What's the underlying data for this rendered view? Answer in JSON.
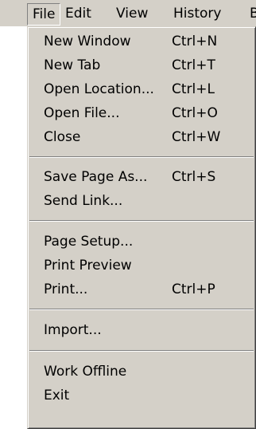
{
  "menubar": {
    "items": [
      {
        "label": "File"
      },
      {
        "label": "Edit"
      },
      {
        "label": "View"
      },
      {
        "label": "History"
      },
      {
        "label": "B"
      }
    ]
  },
  "file_menu": {
    "items": [
      {
        "label": "New Window",
        "shortcut": "Ctrl+N"
      },
      {
        "label": "New Tab",
        "shortcut": "Ctrl+T"
      },
      {
        "label": "Open Location...",
        "shortcut": "Ctrl+L"
      },
      {
        "label": "Open File...",
        "shortcut": "Ctrl+O"
      },
      {
        "label": "Close",
        "shortcut": "Ctrl+W"
      },
      {
        "label": "Save Page As...",
        "shortcut": "Ctrl+S"
      },
      {
        "label": "Send Link..."
      },
      {
        "label": "Page Setup..."
      },
      {
        "label": "Print Preview"
      },
      {
        "label": "Print...",
        "shortcut": "Ctrl+P"
      },
      {
        "label": "Import..."
      },
      {
        "label": "Work Offline"
      },
      {
        "label": "Exit"
      }
    ]
  }
}
